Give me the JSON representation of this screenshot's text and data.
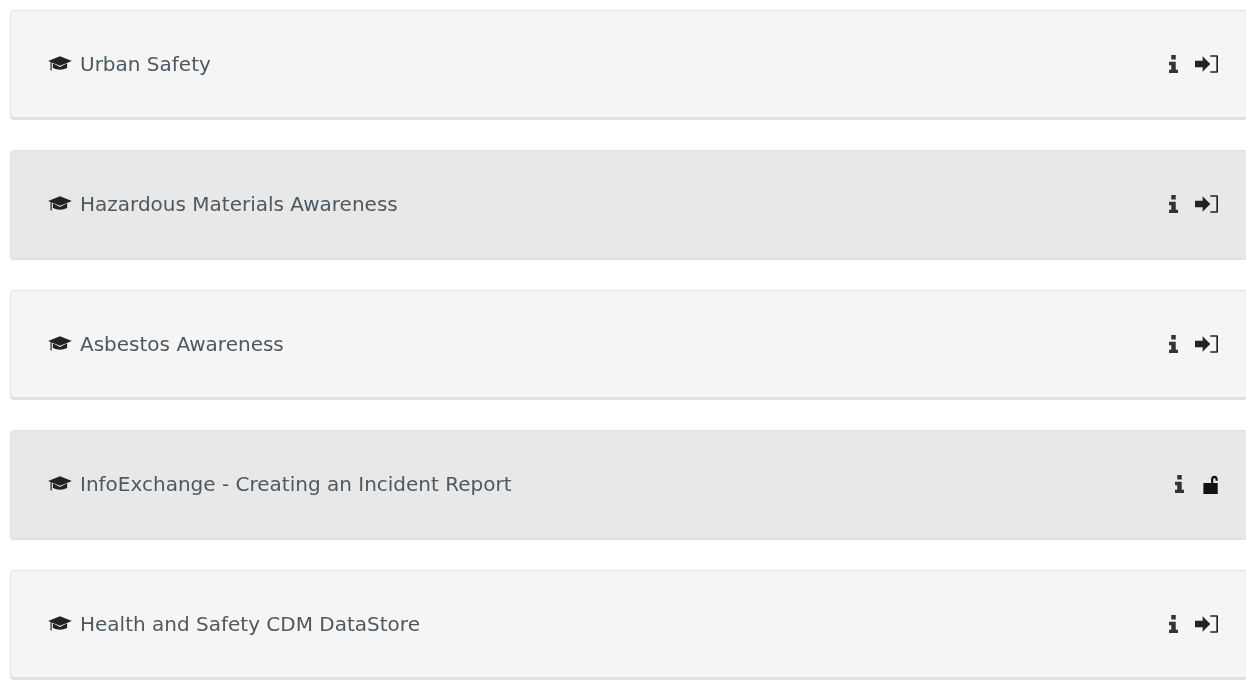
{
  "courses": [
    {
      "title": "Urban Safety",
      "shaded": false,
      "kind": "enter"
    },
    {
      "title": "Hazardous Materials Awareness",
      "shaded": true,
      "kind": "enter"
    },
    {
      "title": "Asbestos Awareness",
      "shaded": false,
      "kind": "enter"
    },
    {
      "title": "InfoExchange - Creating an Incident Report",
      "shaded": true,
      "kind": "unlock"
    },
    {
      "title": "Health and Safety CDM DataStore",
      "shaded": false,
      "kind": "enter"
    }
  ]
}
